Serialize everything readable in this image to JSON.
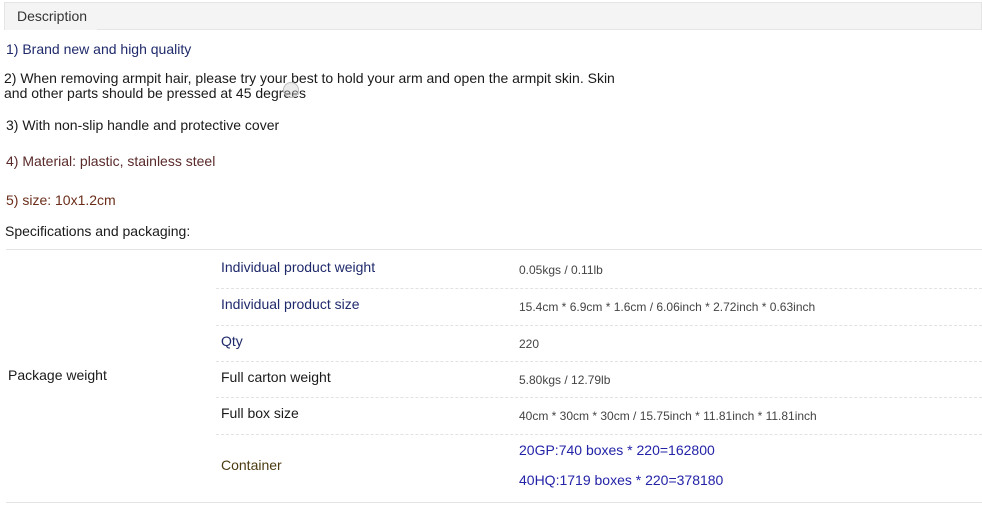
{
  "tab": {
    "label": "Description"
  },
  "description": [
    {
      "text": "1) Brand new and high quality"
    },
    {
      "text": "2) When removing armpit hair, please try your best to hold your arm and open the armpit skin. Skin",
      "text2": "and other parts should be pressed at 45 degrees"
    },
    {
      "text": "3) With non-slip handle and protective cover"
    },
    {
      "text": "4) Material: plastic, stainless steel"
    },
    {
      "text": "5) size: 10x1.2cm"
    }
  ],
  "specs_heading": "Specifications and packaging:",
  "table": {
    "group_label": "Package weight",
    "rows": [
      {
        "label": "Individual product weight",
        "value": "0.05kgs / 0.11lb"
      },
      {
        "label": "Individual product size",
        "value": "15.4cm * 6.9cm * 1.6cm / 6.06inch * 2.72inch * 0.63inch"
      },
      {
        "label": "Qty",
        "value": "220"
      },
      {
        "label": "Full carton weight",
        "value": "5.80kgs / 12.79lb"
      },
      {
        "label": "Full box size",
        "value": "40cm * 30cm * 30cm / 15.75inch * 11.81inch * 11.81inch"
      }
    ],
    "container": {
      "label": "Container",
      "values": [
        "20GP:740 boxes * 220=162800",
        "40HQ:1719 boxes * 220=378180"
      ]
    }
  },
  "colors": {
    "tab_bg": "#f4f4f4",
    "navy_text": "#1f2a6b",
    "blue_text": "#2323a8",
    "brown_text": "#6b2d1a"
  }
}
